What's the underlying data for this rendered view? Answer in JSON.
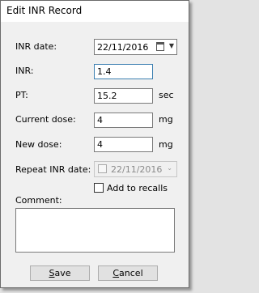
{
  "window": {
    "title": "Edit INR Record"
  },
  "form": {
    "inr_date": {
      "label": "INR date:",
      "value": "22/11/2016"
    },
    "inr": {
      "label": "INR:",
      "value": "1.4"
    },
    "pt": {
      "label": "PT:",
      "value": "15.2",
      "unit": "sec"
    },
    "current_dose": {
      "label": "Current dose:",
      "value": "4",
      "unit": "mg"
    },
    "new_dose": {
      "label": "New dose:",
      "value": "4",
      "unit": "mg"
    },
    "repeat_inr_date": {
      "label": "Repeat INR date:",
      "value": "22/11/2016",
      "enabled": false
    },
    "add_to_recalls": {
      "label": "Add to recalls",
      "checked": false
    },
    "comment": {
      "label": "Comment:",
      "value": ""
    }
  },
  "buttons": {
    "save": {
      "underline": "S",
      "rest": "ave"
    },
    "cancel": {
      "underline": "C",
      "rest": "ancel"
    }
  }
}
